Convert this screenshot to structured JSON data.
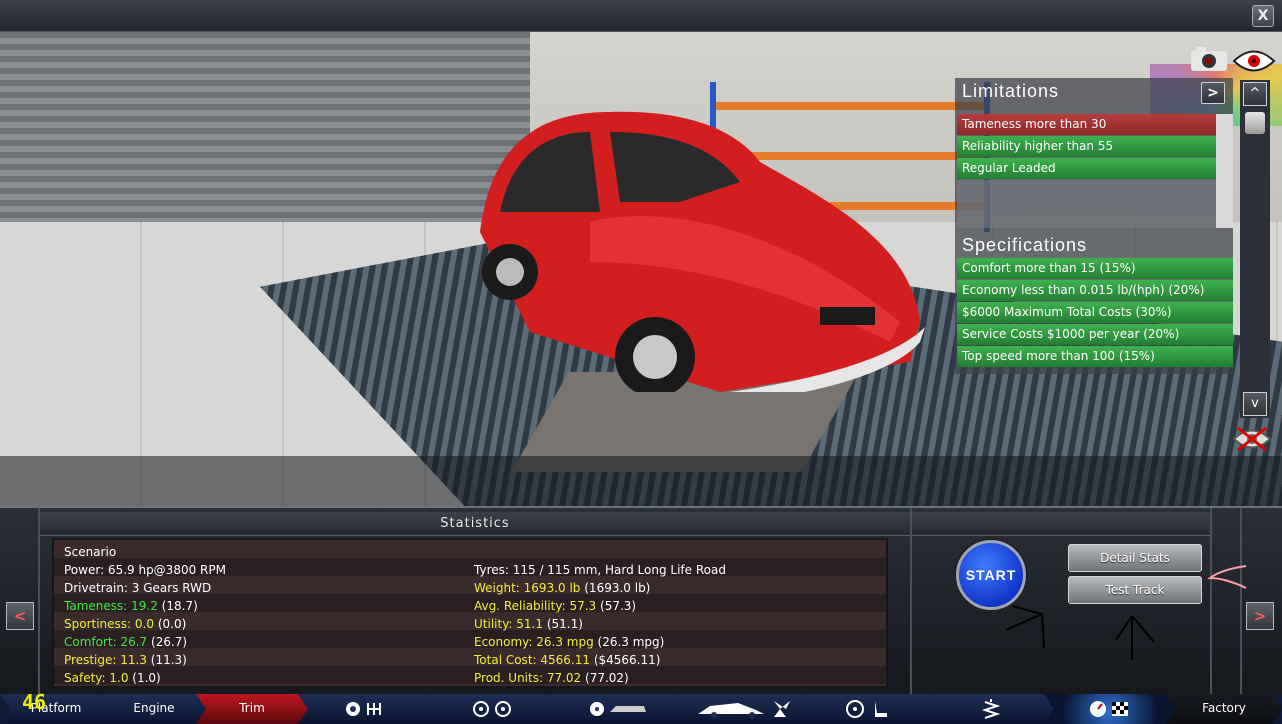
{
  "window": {
    "close_label": "X"
  },
  "limitations": {
    "title": "Limitations",
    "expand_label": ">",
    "items": [
      {
        "label": "Tameness more than 30",
        "status": "fail"
      },
      {
        "label": "Reliability higher than 55",
        "status": "pass"
      },
      {
        "label": "Regular Leaded",
        "status": "pass"
      }
    ]
  },
  "specifications": {
    "title": "Specifications",
    "items": [
      {
        "label": "Comfort more than 15 (15%)"
      },
      {
        "label": "Economy less than 0.015 lb/(hph) (20%)"
      },
      {
        "label": "$6000 Maximum Total Costs (30%)"
      },
      {
        "label": "Service Costs $1000 per year (20%)"
      },
      {
        "label": "Top speed more than 100 (15%)"
      }
    ]
  },
  "scroll": {
    "up_label": "^",
    "down_label": "v"
  },
  "statistics": {
    "title": "Statistics",
    "left": [
      {
        "key": "Scenario",
        "value": "",
        "paren": ""
      },
      {
        "key": "Power: 65.9 hp@3800 RPM",
        "value": "",
        "paren": ""
      },
      {
        "key": "Drivetrain: 3 Gears RWD",
        "value": "",
        "paren": ""
      },
      {
        "key": "Tameness: 19.2",
        "value": "",
        "paren": "(18.7)"
      },
      {
        "key": "Sportiness: 0.0",
        "value": "",
        "paren": "(0.0)"
      },
      {
        "key": "Comfort: 26.7",
        "value": "",
        "paren": "(26.7)"
      },
      {
        "key": "Prestige: 11.3",
        "value": "",
        "paren": "(11.3)"
      },
      {
        "key": "Safety: 1.0",
        "value": "",
        "paren": "(1.0)"
      }
    ],
    "right": [
      {
        "key": "Tyres: 115 / 115 mm, Hard Long Life Road",
        "paren": ""
      },
      {
        "key": "Weight: 1693.0 lb",
        "paren": "(1693.0 lb)"
      },
      {
        "key": "Avg. Reliability: 57.3",
        "paren": "(57.3)"
      },
      {
        "key": "Utility: 51.1",
        "paren": "(51.1)"
      },
      {
        "key": "Economy: 26.3 mpg",
        "paren": "(26.3 mpg)"
      },
      {
        "key": "Total Cost: 4566.11",
        "paren": "($4566.11)"
      },
      {
        "key": "Prod. Units: 77.02",
        "paren": "(77.02)"
      }
    ]
  },
  "actions": {
    "start_label": "START",
    "detail_stats_label": "Detail Stats",
    "test_track_label": "Test Track",
    "prev_label": "<",
    "next_label": ">"
  },
  "tabs": [
    {
      "label": "Platform",
      "state": "normal"
    },
    {
      "label": "Engine",
      "state": "normal"
    },
    {
      "label": "Trim",
      "state": "active"
    },
    {
      "label": "",
      "icon": "gearbox-icon",
      "state": "normal"
    },
    {
      "label": "",
      "icon": "wheels-icon",
      "state": "normal"
    },
    {
      "label": "",
      "icon": "suspension-icon",
      "state": "normal"
    },
    {
      "label": "",
      "icon": "body-fan-icon",
      "state": "normal"
    },
    {
      "label": "",
      "icon": "interior-icon",
      "state": "normal"
    },
    {
      "label": "",
      "icon": "spring-icon",
      "state": "normal"
    },
    {
      "label": "",
      "icon": "testing-icon",
      "state": "glow"
    },
    {
      "label": "Factory",
      "state": "dark"
    }
  ],
  "fps_counter": "46",
  "colors": {
    "fail_row": "#b73c3c",
    "pass_row": "#3fb24f",
    "highlight_text": "#f1ee3c",
    "green_text": "#3ee83e",
    "active_tab": "#c0141e",
    "start_button": "#1236c8"
  }
}
